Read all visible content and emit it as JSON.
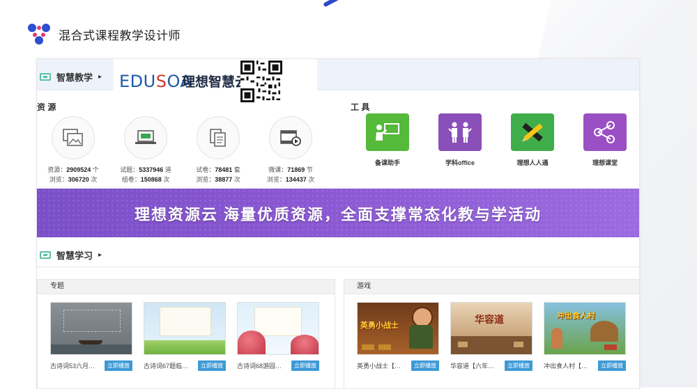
{
  "brand": {
    "title": "混合式课程教学设计师",
    "accent_color": "#2c49c9"
  },
  "section1": {
    "title": "智慧教学",
    "arrow": "▸"
  },
  "logo": {
    "word_a": "EDU",
    "word_o": "S",
    "word_b": "OA",
    "cn": "理想智慧云"
  },
  "resources": {
    "label": "资 源",
    "items": [
      {
        "icon": "images-icon",
        "line1_label": "资源：",
        "line1_value": "2909524",
        "line1_unit": "个",
        "line2_label": "浏览：",
        "line2_value": "306720",
        "line2_unit": "次"
      },
      {
        "icon": "laptop-icon",
        "line1_label": "试题：",
        "line1_value": "5337946",
        "line1_unit": "道",
        "line2_label": "组卷：",
        "line2_value": "150868",
        "line2_unit": "次"
      },
      {
        "icon": "documents-icon",
        "line1_label": "试卷：",
        "line1_value": "78481",
        "line1_unit": "套",
        "line2_label": "浏览：",
        "line2_value": "38877",
        "line2_unit": "次"
      },
      {
        "icon": "video-icon",
        "line1_label": "微课：",
        "line1_value": "71869",
        "line1_unit": "节",
        "line2_label": "浏览：",
        "line2_value": "134437",
        "line2_unit": "次"
      }
    ]
  },
  "tools": {
    "label": "工 具",
    "items": [
      {
        "label": "备课助手",
        "color": "#55b93a",
        "icon": "presenter-icon"
      },
      {
        "label": "学科office",
        "color": "#8a4fb8",
        "icon": "people-icon"
      },
      {
        "label": "理想人人通",
        "color": "#3fae4a",
        "icon": "pencil-ruler-icon"
      },
      {
        "label": "理想课堂",
        "color": "#9b4fc4",
        "icon": "network-icon"
      }
    ]
  },
  "banner": {
    "text": "理想资源云   海量优质资源，全面支撑常态化教与学活动"
  },
  "section2": {
    "title": "智慧学习",
    "arrow": "▸"
  },
  "topics": {
    "title": "专题",
    "cards": [
      {
        "title": "古诗词53六月…",
        "button": "立即播放"
      },
      {
        "title": "古诗词67题临…",
        "button": "立即播放"
      },
      {
        "title": "古诗词68游园…",
        "button": "立即播放"
      }
    ]
  },
  "games": {
    "title": "游戏",
    "cards": [
      {
        "title": "英勇小战士【…",
        "button": "立即播放",
        "thumb_text": "英勇小战士"
      },
      {
        "title": "华容道【六年…",
        "button": "立即播放",
        "thumb_text": "华容道"
      },
      {
        "title": "冲出食人村【…",
        "button": "立即播放",
        "thumb_text": "冲出食人村"
      }
    ]
  }
}
